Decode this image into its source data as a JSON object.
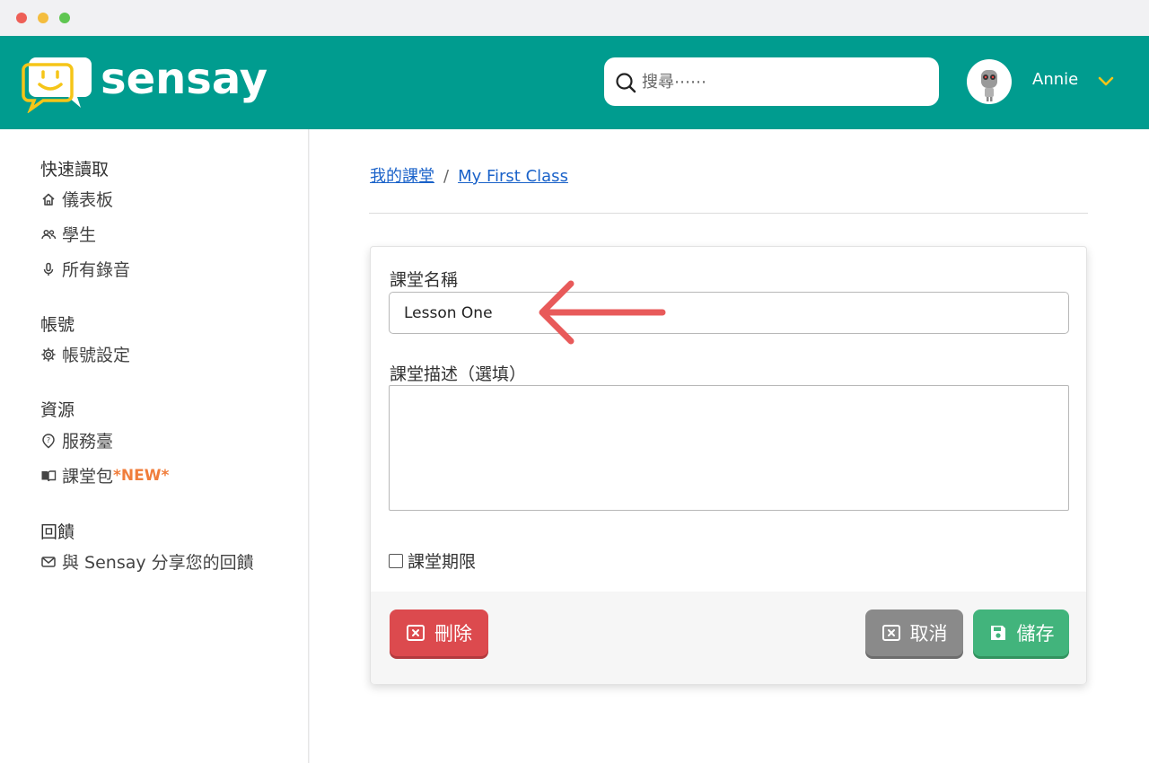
{
  "brand": {
    "name": "sensay",
    "primary_color": "#009c8f",
    "logo_accent": "#f5c518"
  },
  "header": {
    "search_placeholder": "搜尋⋯⋯",
    "user_name": "Annie"
  },
  "sidebar": {
    "sections": [
      {
        "title": "快速讀取",
        "items": [
          {
            "label": "儀表板",
            "icon": "home-icon"
          },
          {
            "label": "學生",
            "icon": "users-icon"
          },
          {
            "label": "所有錄音",
            "icon": "microphone-icon"
          }
        ]
      },
      {
        "title": "帳號",
        "items": [
          {
            "label": "帳號設定",
            "icon": "gear-icon"
          }
        ]
      },
      {
        "title": "資源",
        "items": [
          {
            "label": "服務臺",
            "icon": "help-icon"
          },
          {
            "label": "課堂包",
            "icon": "book-icon",
            "badge": "*NEW*"
          }
        ]
      },
      {
        "title": "回饋",
        "items": [
          {
            "label": "與 Sensay 分享您的回饋",
            "icon": "mail-icon"
          }
        ]
      }
    ]
  },
  "breadcrumb": {
    "root": "我的課堂",
    "separator": "/",
    "current": "My First Class"
  },
  "form": {
    "name_label": "課堂名稱",
    "name_value": "Lesson One",
    "desc_label": "課堂描述（選填）",
    "desc_value": "",
    "deadline_label": "課堂期限",
    "deadline_checked": false
  },
  "actions": {
    "delete_label": "刪除",
    "cancel_label": "取消",
    "save_label": "儲存"
  },
  "colors": {
    "delete": "#dc4a4e",
    "cancel": "#8a8a8a",
    "save": "#42b47c",
    "annotation_arrow": "#e85a5a",
    "new_badge": "#f07d3b"
  }
}
